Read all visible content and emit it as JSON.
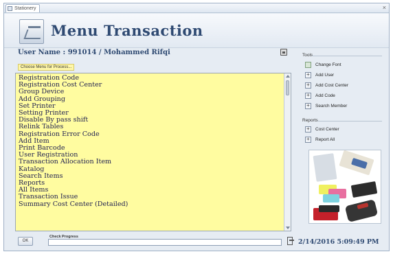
{
  "window": {
    "tab_title": "Stationery",
    "close_glyph": "×"
  },
  "header": {
    "title": "Menu Transaction"
  },
  "user": {
    "label": "User Name : ",
    "id": "991014",
    "separator": " / ",
    "name": "Mohammed Rifqi"
  },
  "hint": "Choose Menu for Process...",
  "menu": {
    "items": [
      "Registration Code",
      "Registration Cost Center",
      "Group Device",
      "Add Grouping",
      "Set Printer",
      "Setting Printer",
      "Disable By pass shift",
      "Relink Tables",
      "Registration Error Code",
      "Add Item",
      "Print Barcode",
      "User Registration",
      "Transaction Allocation Item",
      "Katalog",
      "Search Items",
      "Reports",
      "All Items",
      "Transaction Issue",
      "Summary Cost Center (Detailed)"
    ]
  },
  "side": {
    "tools_label": "Tools",
    "tools": [
      {
        "label": "Change Font",
        "icon": "font-icon"
      },
      {
        "label": "Add User",
        "icon": "plus-icon"
      },
      {
        "label": "Add Cost Center",
        "icon": "plus-icon"
      },
      {
        "label": "Add Code",
        "icon": "plus-icon"
      },
      {
        "label": "Search Member",
        "icon": "plus-icon"
      }
    ],
    "reports_label": "Reports",
    "reports": [
      {
        "label": "Cost Center",
        "icon": "plus-icon"
      },
      {
        "label": "Report All",
        "icon": "plus-icon"
      }
    ]
  },
  "footer": {
    "ok_label": "OK",
    "progress_label": "Check Progress",
    "datetime": "2/14/2016 5:09:49 PM"
  },
  "colors": {
    "accent": "#2f4a72",
    "list_bg": "#fffca0"
  }
}
